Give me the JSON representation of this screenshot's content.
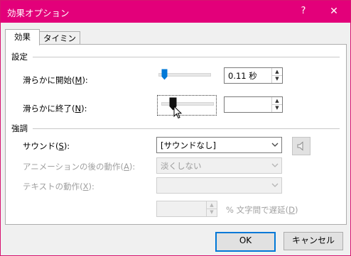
{
  "window": {
    "title": "効果オプション",
    "help_label": "?",
    "close_label": "✕"
  },
  "tabs": [
    {
      "label": "効果",
      "active": true
    },
    {
      "label": "タイミング",
      "active": false
    }
  ],
  "settings": {
    "section_title": "設定",
    "smooth_start": {
      "label": "滑らかに開始(",
      "mnemonic": "M",
      "label_end": "):",
      "value": "0.11 秒",
      "slider_fraction": 0.03
    },
    "smooth_end": {
      "label": "滑らかに終了(",
      "mnemonic": "N",
      "label_end": "):",
      "value": "",
      "slider_fraction": 0.05
    }
  },
  "enhancements": {
    "section_title": "強調",
    "sound": {
      "label": "サウンド(",
      "mnemonic": "S",
      "label_end": "):",
      "value": "[サウンドなし]"
    },
    "after_animation": {
      "label": "アニメーションの後の動作(",
      "mnemonic": "A",
      "label_end": "):",
      "value": "淡くしない"
    },
    "animate_text": {
      "label": "テキストの動作(",
      "mnemonic": "X",
      "label_end": "):",
      "value": ""
    },
    "delay": {
      "value": "",
      "suffix": "% 文字間で遅延(",
      "mnemonic": "D",
      "suffix_end": ")"
    }
  },
  "buttons": {
    "ok": "OK",
    "cancel": "キャンセル"
  },
  "colors": {
    "titlebar": "#e3007a",
    "slider_thumb": "#0078d7",
    "default_button_border": "#0078d7"
  }
}
